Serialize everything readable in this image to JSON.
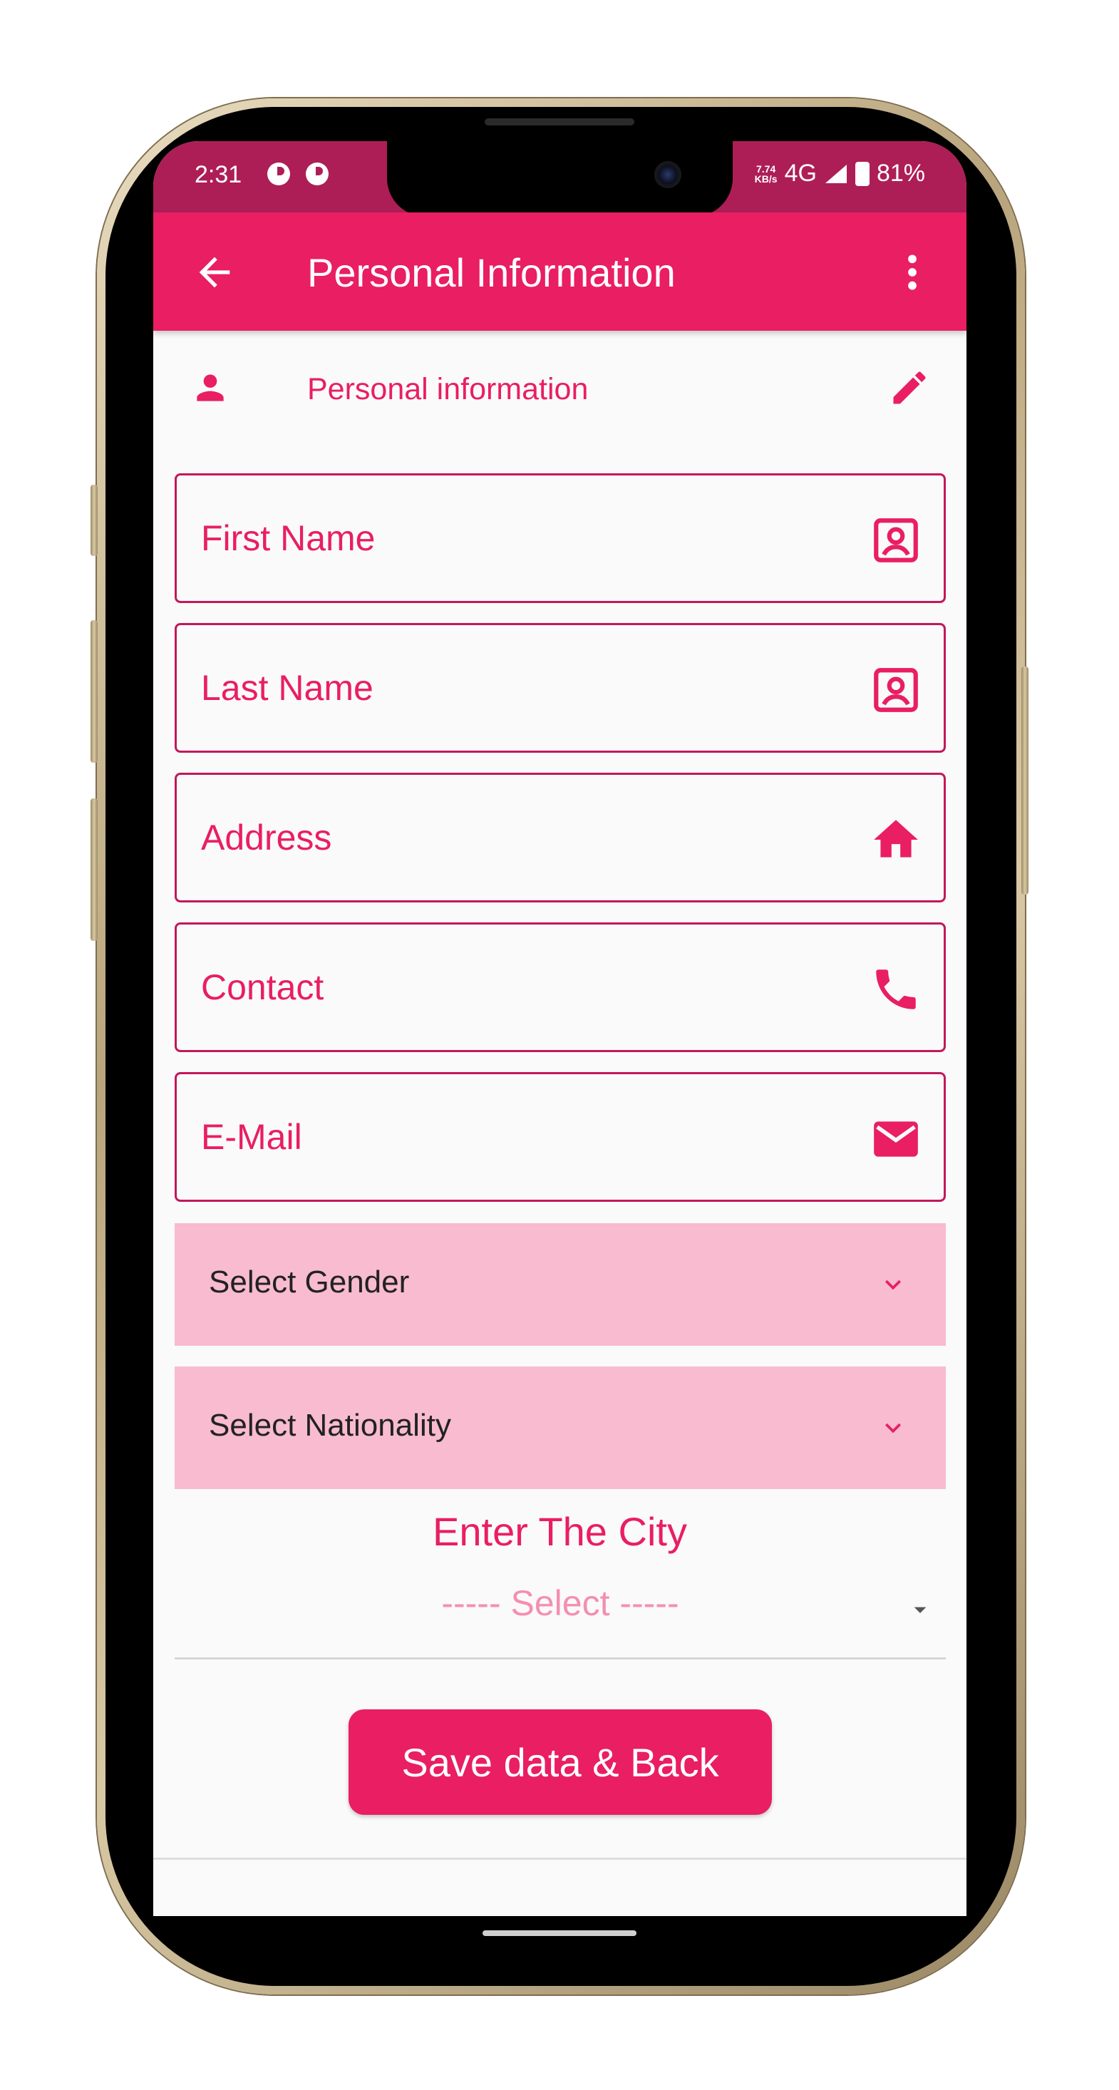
{
  "status_bar": {
    "time": "2:31",
    "speed_value": "7.74",
    "speed_unit": "KB/s",
    "network": "4G",
    "battery": "81%"
  },
  "app_bar": {
    "title": "Personal Information",
    "back_icon": "arrow-left-icon",
    "more_icon": "more-vert-icon"
  },
  "section": {
    "label": "Personal information",
    "icon": "person-icon",
    "edit_icon": "pencil-icon"
  },
  "fields": {
    "first_name": {
      "placeholder": "First Name",
      "value": "",
      "icon": "contact-card-icon"
    },
    "last_name": {
      "placeholder": "Last Name",
      "value": "",
      "icon": "contact-card-icon"
    },
    "address": {
      "placeholder": "Address",
      "value": "",
      "icon": "home-icon"
    },
    "contact": {
      "placeholder": "Contact",
      "value": "",
      "icon": "phone-icon"
    },
    "email": {
      "placeholder": "E-Mail",
      "value": "",
      "icon": "mail-icon"
    }
  },
  "dropdowns": {
    "gender": {
      "label": "Select Gender",
      "icon": "chevron-down-icon"
    },
    "nationality": {
      "label": "Select Nationality",
      "icon": "chevron-down-icon"
    }
  },
  "city": {
    "title": "Enter The City",
    "placeholder": "----- Select -----",
    "icon": "caret-down-icon"
  },
  "actions": {
    "save_label": "Save data & Back"
  },
  "colors": {
    "primary": "#e91e63",
    "primary_dark": "#ad1e56",
    "field_border": "#c2185b",
    "dropdown_bg": "#f8bbd0",
    "placeholder_light": "#f48fb1",
    "screen_bg": "#fafafa"
  }
}
